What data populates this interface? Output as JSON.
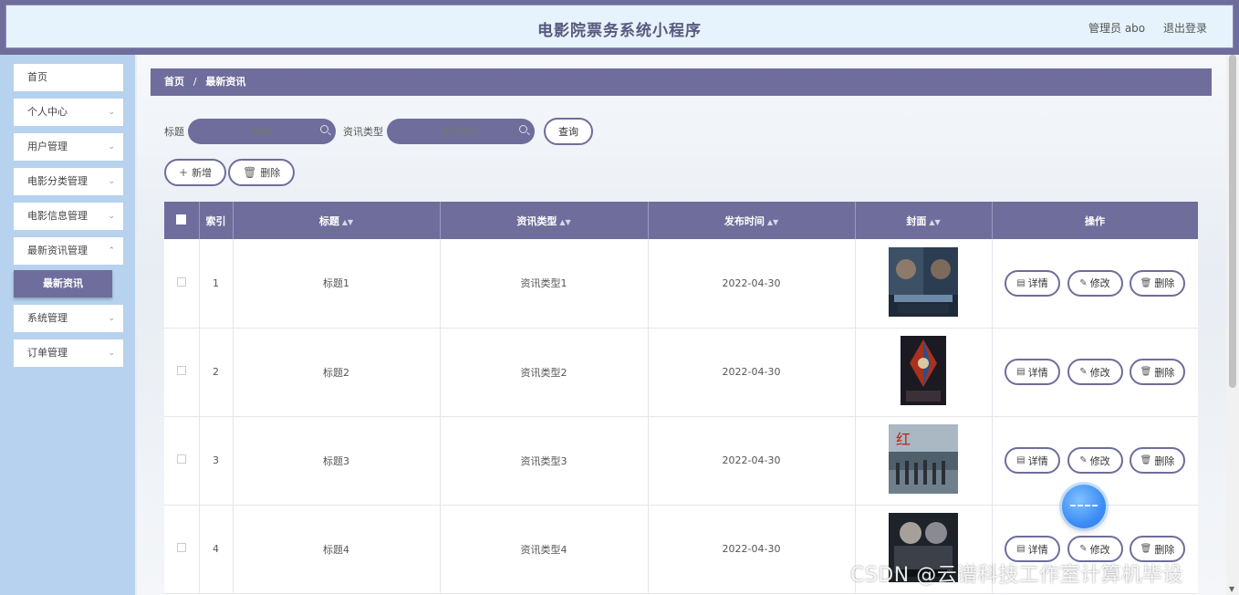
{
  "header": {
    "title": "电影院票务系统小程序",
    "user_label": "管理员 abo",
    "logout_label": "退出登录"
  },
  "sidebar": {
    "items": [
      {
        "label": "首页",
        "has_chevron": false
      },
      {
        "label": "个人中心",
        "has_chevron": true
      },
      {
        "label": "用户管理",
        "has_chevron": true
      },
      {
        "label": "电影分类管理",
        "has_chevron": true
      },
      {
        "label": "电影信息管理",
        "has_chevron": true
      },
      {
        "label": "最新资讯管理",
        "has_chevron": true
      },
      {
        "label": "系统管理",
        "has_chevron": true
      },
      {
        "label": "订单管理",
        "has_chevron": true
      }
    ],
    "active_sub": "最新资讯"
  },
  "breadcrumb": {
    "home": "首页",
    "separator": "/",
    "current": "最新资讯"
  },
  "search": {
    "title_label": "标题",
    "title_placeholder": "标题",
    "type_label": "资讯类型",
    "type_placeholder": "资讯类型",
    "query_label": "查询"
  },
  "actions": {
    "add_label": "新增",
    "delete_label": "删除"
  },
  "table": {
    "headers": {
      "index": "索引",
      "title": "标题",
      "type": "资讯类型",
      "date": "发布时间",
      "cover": "封面",
      "ops": "操作"
    },
    "rows": [
      {
        "index": "1",
        "title": "标题1",
        "type": "资讯类型1",
        "date": "2022-04-30"
      },
      {
        "index": "2",
        "title": "标题2",
        "type": "资讯类型2",
        "date": "2022-04-30"
      },
      {
        "index": "3",
        "title": "标题3",
        "type": "资讯类型3",
        "date": "2022-04-30"
      },
      {
        "index": "4",
        "title": "标题4",
        "type": "资讯类型4",
        "date": "2022-04-30"
      }
    ],
    "row_buttons": {
      "detail": "详情",
      "edit": "修改",
      "delete": "删除"
    }
  },
  "watermark": "CSDN @云谱科技工作室计算机毕设",
  "colors": {
    "accent": "#6f6d9b",
    "sidebar_bg": "#b6d2ee",
    "header_bg": "#e6f3fc"
  }
}
